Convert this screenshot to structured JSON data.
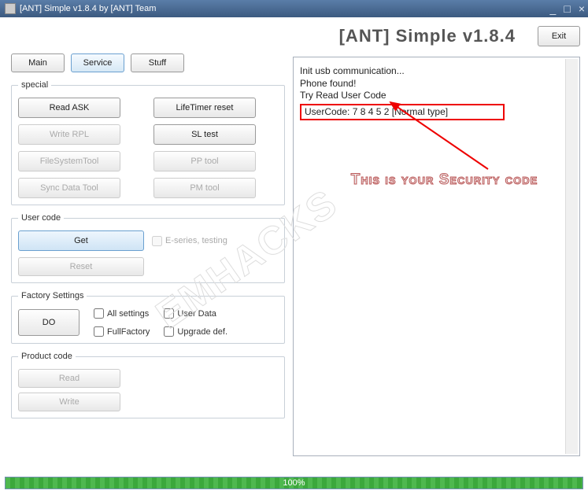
{
  "window": {
    "title": "[ANT] Simple v1.8.4 by [ANT] Team"
  },
  "header": {
    "app_title": "[ANT] Simple v1.8.4",
    "exit": "Exit"
  },
  "tabs": {
    "main": "Main",
    "service": "Service",
    "stuff": "Stuff"
  },
  "special": {
    "legend": "special",
    "read_ask": "Read ASK",
    "lifetimer": "LifeTimer reset",
    "write_rpl": "Write RPL",
    "sl_test": "SL test",
    "filesystem": "FileSystemTool",
    "pp_tool": "PP tool",
    "sync_data": "Sync Data Tool",
    "pm_tool": "PM tool"
  },
  "usercode": {
    "legend": "User code",
    "get": "Get",
    "reset": "Reset",
    "eseries": "E-series, testing"
  },
  "factory": {
    "legend": "Factory Settings",
    "all": "All settings",
    "userdata": "User Data",
    "fullfactory": "FullFactory",
    "upgrade": "Upgrade def.",
    "do": "DO"
  },
  "product": {
    "legend": "Product code",
    "read": "Read",
    "write": "Write"
  },
  "log": {
    "l1": "Init usb communication...",
    "l2": "Phone found!",
    "l3": "Try Read User Code",
    "l4": "UserCode: 7 8 4 5 2         [Normal type]"
  },
  "annotation": "This is your Security code",
  "watermark": "EMHACKS",
  "progress": "100%"
}
